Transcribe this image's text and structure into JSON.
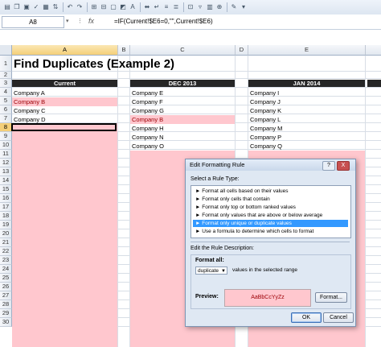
{
  "formula_bar": {
    "name_box": "A8",
    "fx_label": "fx",
    "formula": "=IF(Current!$E6=0,\"\",Current!$E6)"
  },
  "columns": [
    "A",
    "B",
    "C",
    "D",
    "E"
  ],
  "rows": [
    "1",
    "2",
    "3",
    "4",
    "5",
    "6",
    "7",
    "8",
    "9",
    "10",
    "11",
    "12",
    "13",
    "14",
    "15",
    "16",
    "17",
    "18",
    "19",
    "20",
    "21",
    "22",
    "23",
    "24",
    "25",
    "26",
    "27",
    "28",
    "29",
    "30"
  ],
  "sheet": {
    "title": "Find Duplicates (Example 2)",
    "current": {
      "header": "Current",
      "items": [
        "Company A",
        "Company B",
        "Company C",
        "Company D"
      ]
    },
    "dec": {
      "header": "DEC 2013",
      "items": [
        "Company E",
        "Company F",
        "Company G",
        "Company B",
        "Company H",
        "Company N",
        "Company O"
      ]
    },
    "jan": {
      "header": "JAN 2014",
      "items": [
        "Company I",
        "Company J",
        "Company K",
        "Company L",
        "Company M",
        "Company P",
        "Company Q"
      ]
    }
  },
  "dialog": {
    "title": "Edit Formatting Rule",
    "help": "?",
    "close": "X",
    "select_rule_type_label": "Select a Rule Type:",
    "rule_types": [
      "► Format all cells based on their values",
      "► Format only cells that contain",
      "► Format only top or bottom ranked values",
      "► Format only values that are above or below average",
      "► Format only unique or duplicate values",
      "► Use a formula to determine which cells to format"
    ],
    "selected_rule_index": 4,
    "edit_description_label": "Edit the Rule Description:",
    "format_all_label": "Format all:",
    "format_all_value": "duplicate",
    "values_note": "values in the selected range",
    "preview_label": "Preview:",
    "preview_text": "AaBbCcYyZz",
    "format_button": "Format...",
    "ok_button": "OK",
    "cancel_button": "Cancel"
  },
  "colors": {
    "highlight_fill": "#ffc7ce",
    "highlight_text": "#9c0006",
    "header_fill": "#262626",
    "selected_rule": "#3399ff"
  }
}
